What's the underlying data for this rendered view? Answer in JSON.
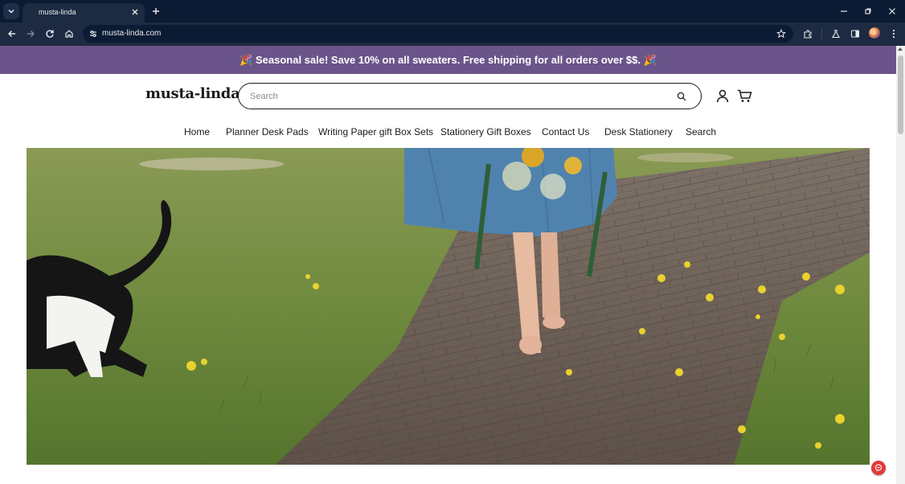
{
  "browser": {
    "tab": {
      "title": "musta-linda",
      "icon": "tab-favicon"
    },
    "address_bar": {
      "url": "musta-linda.com"
    },
    "colors": {
      "frame": "#0b1b33",
      "toolbar": "#1d2b42"
    }
  },
  "site": {
    "announcement": "🎉 Seasonal sale! Save 10% on all sweaters. Free shipping for all orders over $$. 🎉",
    "logo": "musta-linda",
    "search": {
      "placeholder": "Search",
      "value": ""
    },
    "nav": [
      {
        "label": "Home"
      },
      {
        "label": "Planner Desk Pads"
      },
      {
        "label": "Writing Paper gift Box Sets"
      },
      {
        "label": "Stationery Gift Boxes"
      },
      {
        "label": "Contact Us"
      },
      {
        "label": "Desk Stationery"
      },
      {
        "label": "Search"
      }
    ],
    "colors": {
      "announcement_bg": "#6b548a",
      "text": "#1b1b1b",
      "chat_button": "#e03a3a"
    },
    "icons": [
      "search-icon",
      "account-icon",
      "cart-icon",
      "chat-icon"
    ]
  }
}
